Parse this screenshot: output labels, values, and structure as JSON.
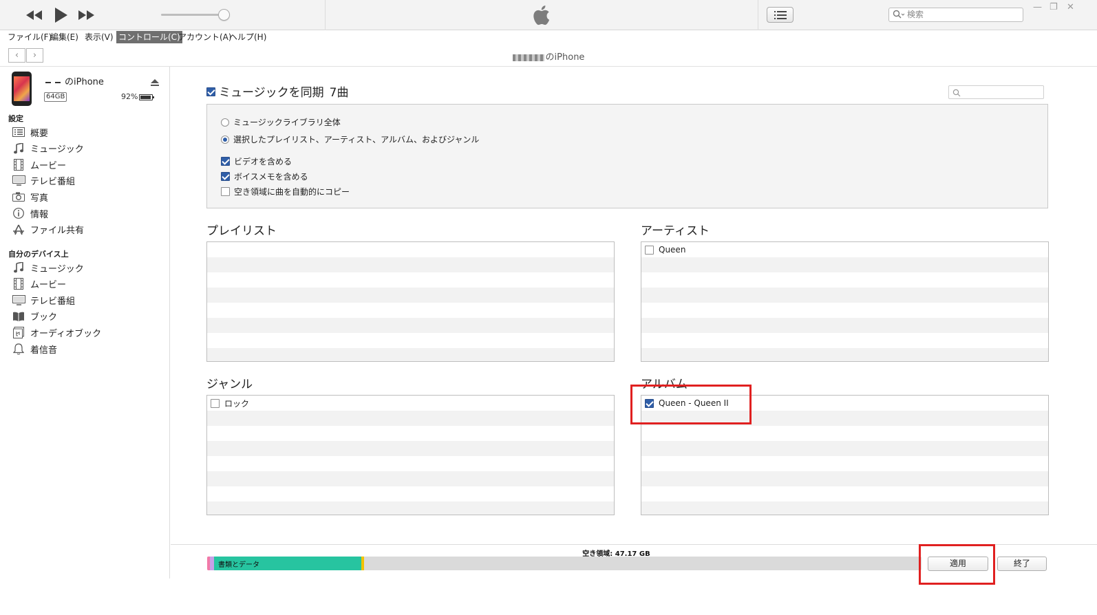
{
  "toolbar": {
    "search_placeholder": "検索",
    "icons": [
      "rewind-icon",
      "play-icon",
      "fast-forward-icon",
      "apple-logo",
      "list-view-icon",
      "search-icon"
    ]
  },
  "menu": {
    "items": [
      "ファイル(F)",
      "編集(E)",
      "表示(V)",
      "コントロール(C)",
      "アカウント(A)",
      "ヘルプ(H)"
    ],
    "active": "コントロール(C)"
  },
  "nav": {
    "device_title": "のiPhone"
  },
  "sidebar": {
    "device_name": "のiPhone",
    "capacity": "64GB",
    "battery": "92%",
    "settings_header": "設定",
    "settings_items": [
      {
        "label": "概要",
        "icon": "summary-icon"
      },
      {
        "label": "ミュージック",
        "icon": "music-note-icon"
      },
      {
        "label": "ムービー",
        "icon": "film-icon"
      },
      {
        "label": "テレビ番組",
        "icon": "tv-icon"
      },
      {
        "label": "写真",
        "icon": "camera-icon"
      },
      {
        "label": "情報",
        "icon": "info-icon"
      },
      {
        "label": "ファイル共有",
        "icon": "app-store-icon"
      }
    ],
    "device_header": "自分のデバイス上",
    "device_items": [
      {
        "label": "ミュージック",
        "icon": "music-note-icon"
      },
      {
        "label": "ムービー",
        "icon": "film-icon"
      },
      {
        "label": "テレビ番組",
        "icon": "tv-icon"
      },
      {
        "label": "ブック",
        "icon": "book-icon"
      },
      {
        "label": "オーディオブック",
        "icon": "audiobook-icon"
      },
      {
        "label": "着信音",
        "icon": "bell-icon"
      }
    ]
  },
  "main": {
    "sync_label": "ミュージックを同期",
    "sync_count": "7曲",
    "sync_checked": true,
    "options": {
      "radio_all": "ミュージックライブラリ全体",
      "radio_selected": "選択したプレイリスト、アーティスト、アルバム、およびジャンル",
      "selected_mode": "selected",
      "include_videos": "ビデオを含める",
      "include_voice_memos": "ボイスメモを含める",
      "autofill": "空き領域に曲を自動的にコピー",
      "include_videos_checked": true,
      "include_voice_memos_checked": true,
      "autofill_checked": false
    },
    "playlists": {
      "title": "プレイリスト",
      "items": []
    },
    "artists": {
      "title": "アーティスト",
      "items": [
        {
          "label": "Queen",
          "checked": false
        }
      ]
    },
    "genres": {
      "title": "ジャンル",
      "items": [
        {
          "label": "ロック",
          "checked": false
        }
      ]
    },
    "albums": {
      "title": "アルバム",
      "items": [
        {
          "label": "Queen - Queen II",
          "checked": true
        }
      ]
    }
  },
  "bottom": {
    "storage_segment_label": "書類とデータ",
    "free_space": "空き領域: 47.17 GB",
    "apply_label": "適用",
    "done_label": "終了",
    "segment_colors": [
      "#f27aa8",
      "#c7a0e8",
      "#27c4a0",
      "#f2c200"
    ]
  },
  "colors": {
    "highlight_red": "#e02020",
    "checkbox_blue": "#2f5ea8"
  }
}
